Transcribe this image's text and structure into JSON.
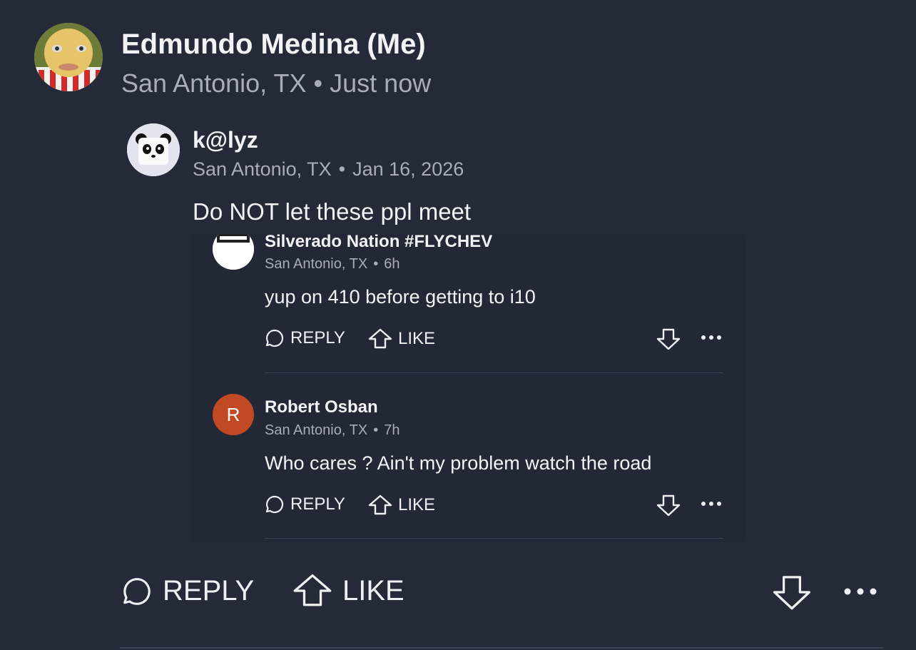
{
  "post": {
    "author": "Edmundo Medina (Me)",
    "location": "San Antonio, TX",
    "time": "Just now"
  },
  "quoted": {
    "author": "k@lyz",
    "location": "San Antonio, TX",
    "time": "Jan 16, 2026",
    "text": "Do NOT let these ppl meet",
    "comments": [
      {
        "author": "Silverado Nation #FLYCHEV",
        "location": "San Antonio, TX",
        "time": "6h",
        "text": "yup on 410 before getting to i10",
        "reply_label": "REPLY",
        "like_label": "LIKE"
      },
      {
        "author": "Robert Osban",
        "avatar_letter": "R",
        "avatar_color": "#c14a25",
        "location": "San Antonio, TX",
        "time": "7h",
        "text": "Who cares ? Ain't my problem watch the road",
        "reply_label": "REPLY",
        "like_label": "LIKE"
      }
    ]
  },
  "actions": {
    "reply_label": "REPLY",
    "like_label": "LIKE"
  },
  "separator": "•",
  "icons": [
    "reply-bubble-icon",
    "like-arrow-up-icon",
    "downvote-arrow-icon",
    "more-dots-icon"
  ]
}
